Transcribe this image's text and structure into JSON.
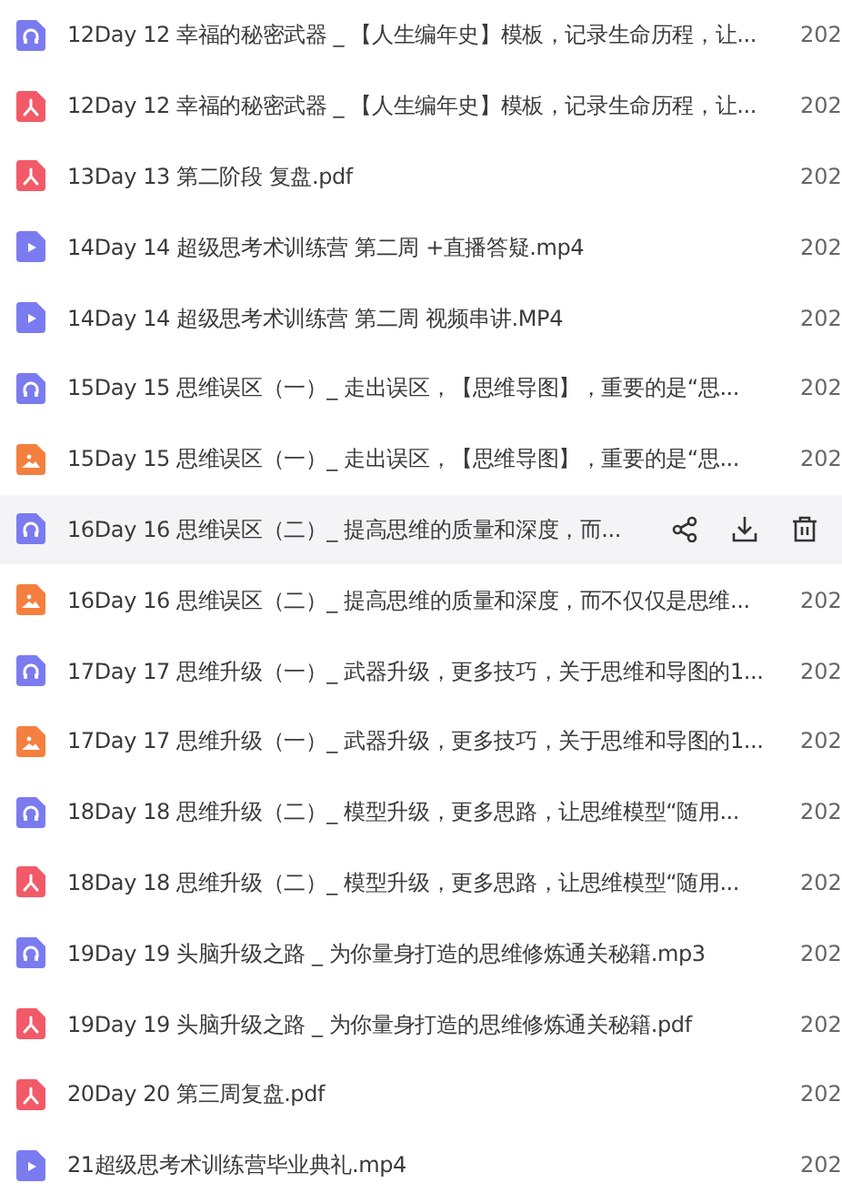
{
  "files": [
    {
      "kind": "audio",
      "name": "12Day 12 幸福的秘密武器 _ 【人生编年史】模板，记录生命历程，让...",
      "date": "202",
      "hovered": false
    },
    {
      "kind": "pdf",
      "name": "12Day 12 幸福的秘密武器 _ 【人生编年史】模板，记录生命历程，让...",
      "date": "202",
      "hovered": false
    },
    {
      "kind": "pdf",
      "name": "13Day 13 第二阶段  复盘.pdf",
      "date": "202",
      "hovered": false
    },
    {
      "kind": "video",
      "name": "14Day 14 超级思考术训练营 第二周 +直播答疑.mp4",
      "date": "202",
      "hovered": false
    },
    {
      "kind": "video",
      "name": "14Day 14 超级思考术训练营 第二周 视频串讲.MP4",
      "date": "202",
      "hovered": false
    },
    {
      "kind": "audio",
      "name": "15Day 15 思维误区（一）_ 走出误区，【思维导图】，重要的是“思...",
      "date": "202",
      "hovered": false
    },
    {
      "kind": "image",
      "name": "15Day 15 思维误区（一）_ 走出误区，【思维导图】，重要的是“思...",
      "date": "202",
      "hovered": false
    },
    {
      "kind": "audio",
      "name": "16Day 16 思维误区（二）_ 提高思维的质量和深度，而...",
      "hovered": true
    },
    {
      "kind": "image",
      "name": "16Day 16 思维误区（二）_ 提高思维的质量和深度，而不仅仅是思维...",
      "date": "202",
      "hovered": false
    },
    {
      "kind": "audio",
      "name": "17Day 17 思维升级（一）_ 武器升级，更多技巧，关于思维和导图的1...",
      "date": "202",
      "hovered": false
    },
    {
      "kind": "image",
      "name": "17Day 17 思维升级（一）_ 武器升级，更多技巧，关于思维和导图的1...",
      "date": "202",
      "hovered": false
    },
    {
      "kind": "audio",
      "name": "18Day 18 思维升级（二）_ 模型升级，更多思路，让思维模型“随用...",
      "date": "202",
      "hovered": false
    },
    {
      "kind": "pdf",
      "name": "18Day 18 思维升级（二）_ 模型升级，更多思路，让思维模型“随用...",
      "date": "202",
      "hovered": false
    },
    {
      "kind": "audio",
      "name": "19Day 19 头脑升级之路 _ 为你量身打造的思维修炼通关秘籍.mp3",
      "date": "202",
      "hovered": false
    },
    {
      "kind": "pdf",
      "name": "19Day 19 头脑升级之路 _ 为你量身打造的思维修炼通关秘籍.pdf",
      "date": "202",
      "hovered": false
    },
    {
      "kind": "pdf",
      "name": "20Day 20 第三周复盘.pdf",
      "date": "202",
      "hovered": false
    },
    {
      "kind": "video",
      "name": "21超级思考术训练营毕业典礼.mp4",
      "date": "202",
      "hovered": false
    }
  ]
}
